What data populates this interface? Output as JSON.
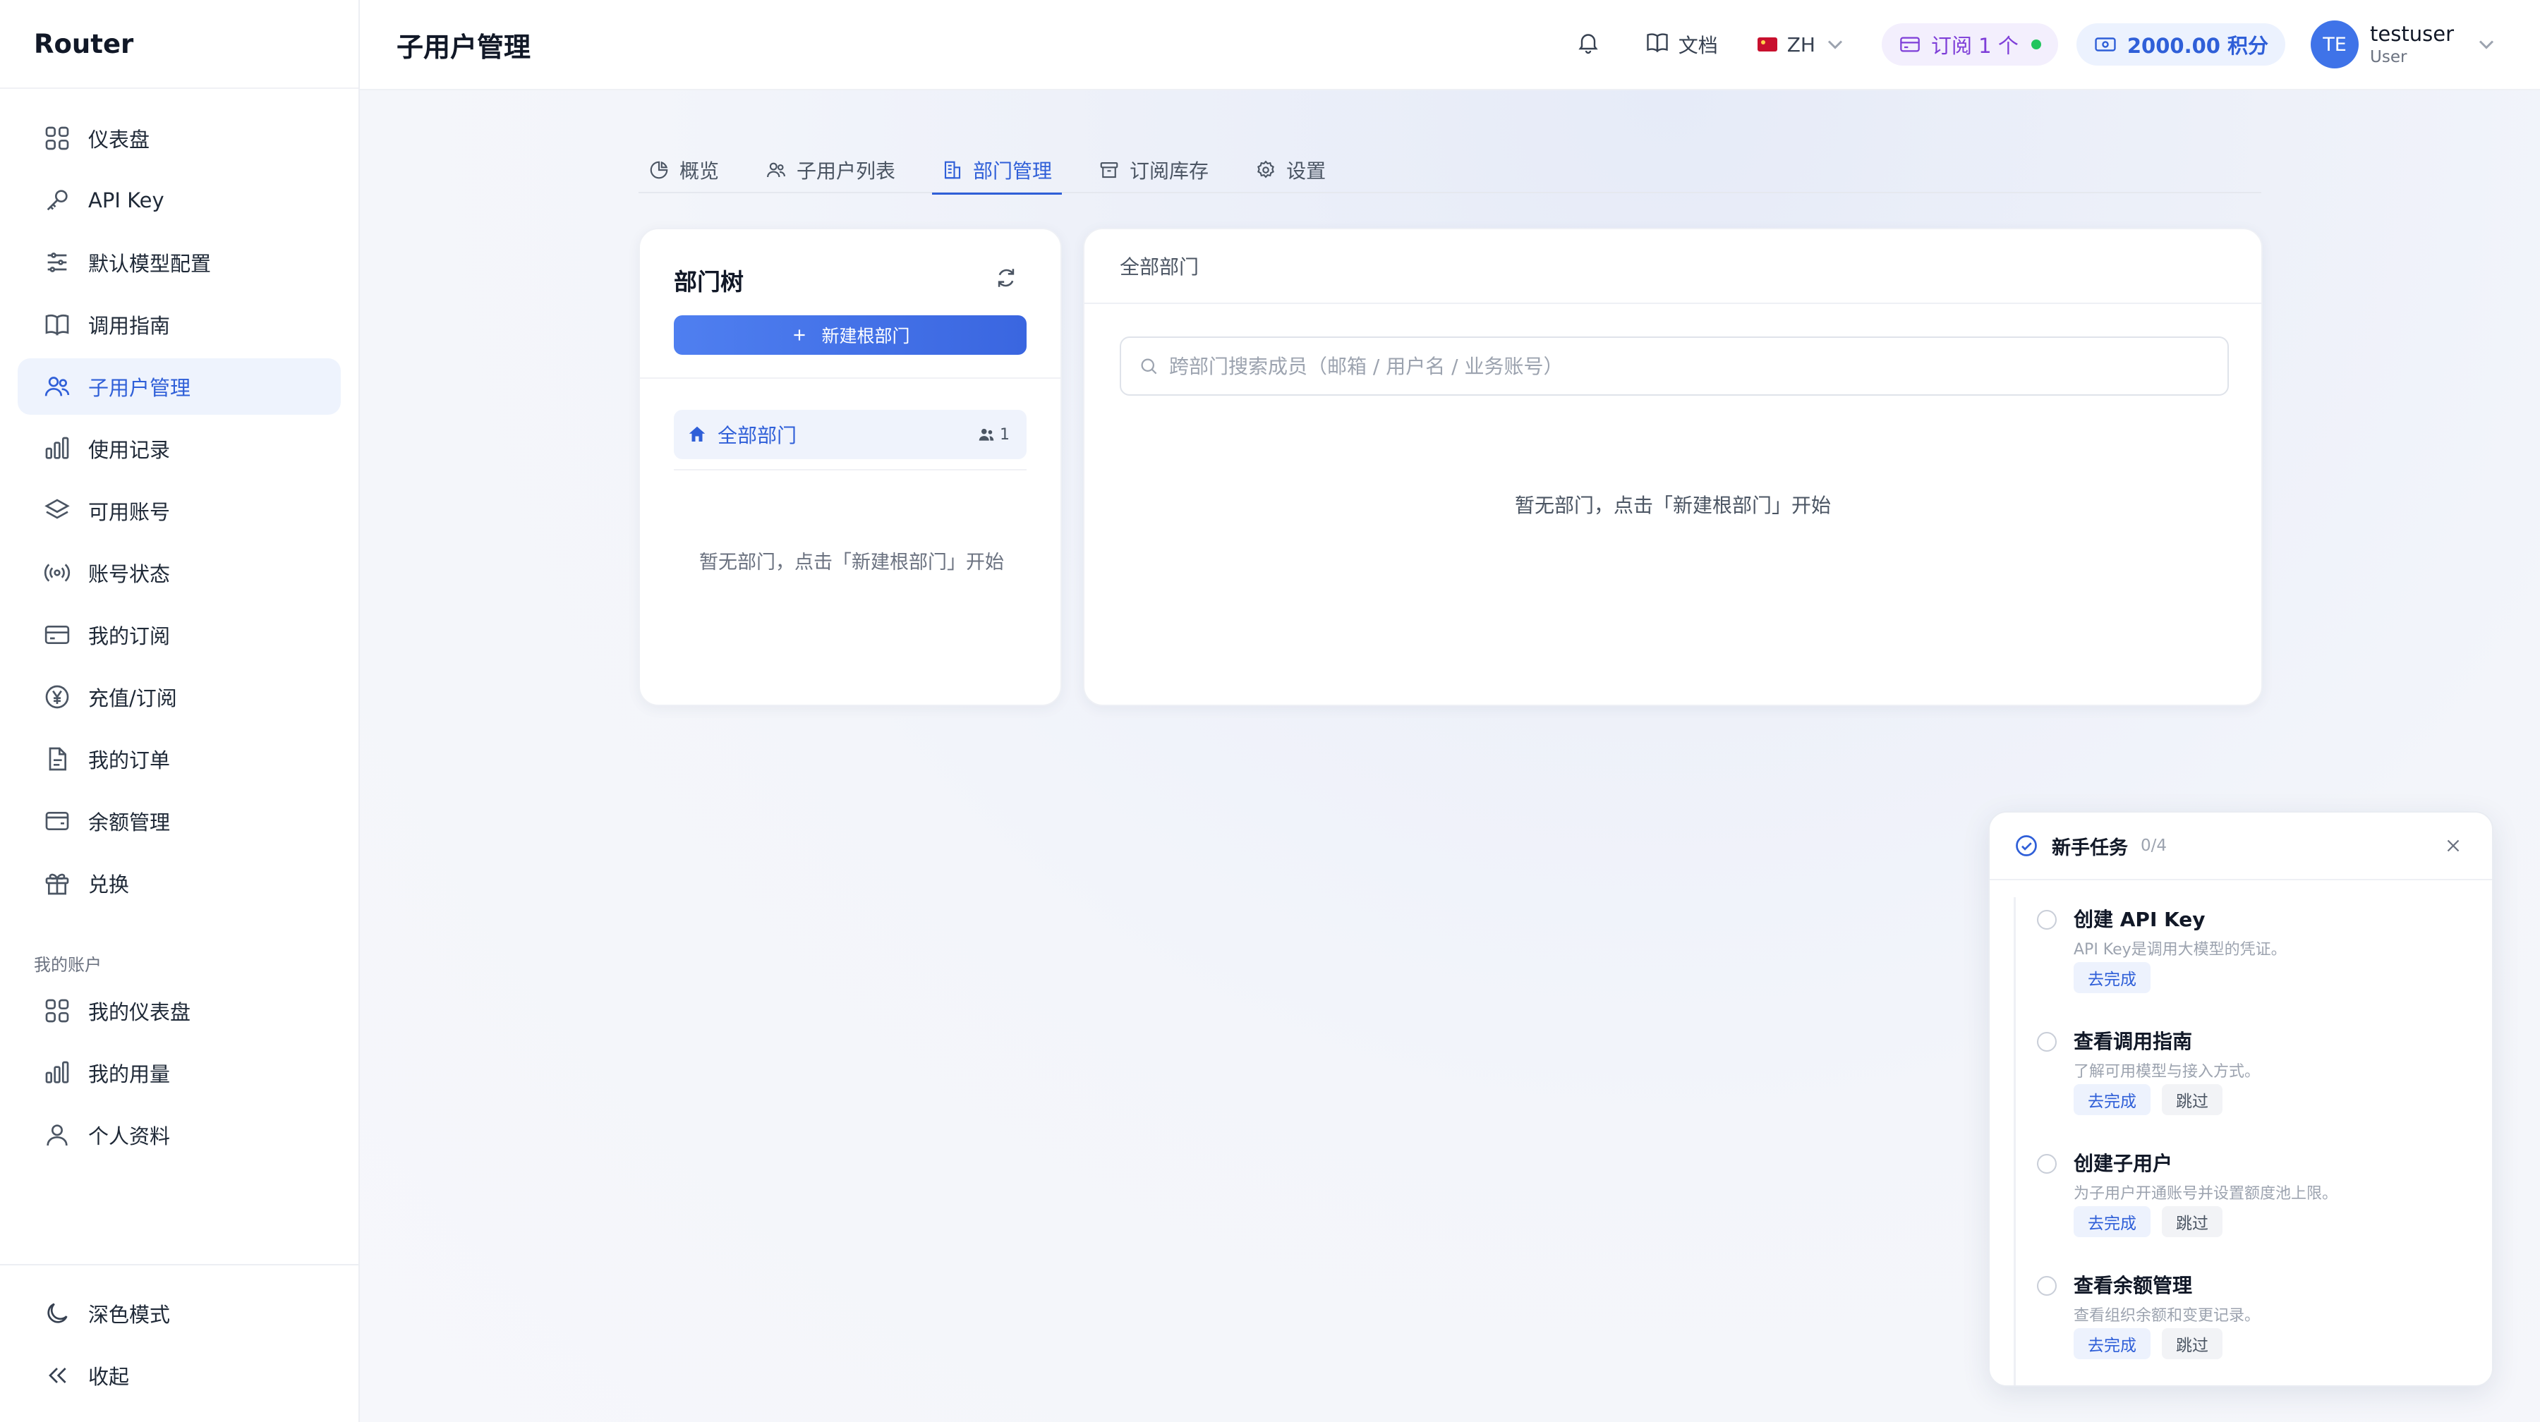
{
  "brand": "Router",
  "sidebar": {
    "items": [
      {
        "label": "仪表盘",
        "icon": "grid-icon"
      },
      {
        "label": "API Key",
        "icon": "key-icon"
      },
      {
        "label": "默认模型配置",
        "icon": "sliders-icon"
      },
      {
        "label": "调用指南",
        "icon": "book-icon"
      },
      {
        "label": "子用户管理",
        "icon": "users-icon",
        "active": true
      },
      {
        "label": "使用记录",
        "icon": "bar-chart-icon"
      },
      {
        "label": "可用账号",
        "icon": "layers-icon"
      },
      {
        "label": "账号状态",
        "icon": "broadcast-icon"
      },
      {
        "label": "我的订阅",
        "icon": "credit-card-icon"
      },
      {
        "label": "充值/订阅",
        "icon": "yen-icon"
      },
      {
        "label": "我的订单",
        "icon": "file-icon"
      },
      {
        "label": "余额管理",
        "icon": "wallet-icon"
      },
      {
        "label": "兑换",
        "icon": "gift-icon"
      }
    ],
    "section_label": "我的账户",
    "account_items": [
      {
        "label": "我的仪表盘",
        "icon": "grid-icon"
      },
      {
        "label": "我的用量",
        "icon": "bar-chart-icon"
      },
      {
        "label": "个人资料",
        "icon": "user-icon"
      }
    ],
    "bottom": {
      "dark_mode": "深色模式",
      "collapse": "收起"
    }
  },
  "header": {
    "title": "子用户管理",
    "docs": "文档",
    "lang": "ZH",
    "subscription": "订阅 1 个",
    "points": "2000.00 积分",
    "avatar_initials": "TE",
    "username": "testuser",
    "role": "User"
  },
  "tabs": [
    {
      "label": "概览",
      "icon": "pie-icon"
    },
    {
      "label": "子用户列表",
      "icon": "users-icon"
    },
    {
      "label": "部门管理",
      "icon": "building-icon",
      "active": true
    },
    {
      "label": "订阅库存",
      "icon": "archive-icon"
    },
    {
      "label": "设置",
      "icon": "gear-icon"
    }
  ],
  "tree": {
    "title": "部门树",
    "new_root_button": "新建根部门",
    "all_node": "全部部门",
    "all_count": "1",
    "empty_text": "暂无部门，点击「新建根部门」开始"
  },
  "dept_panel": {
    "header": "全部部门",
    "search_placeholder": "跨部门搜索成员（邮箱 / 用户名 / 业务账号）",
    "empty_text": "暂无部门，点击「新建根部门」开始"
  },
  "onboarding": {
    "title": "新手任务",
    "progress": "0/4",
    "tasks": [
      {
        "title": "创建 API Key",
        "desc": "API Key是调用大模型的凭证。",
        "go": "去完成",
        "skip": ""
      },
      {
        "title": "查看调用指南",
        "desc": "了解可用模型与接入方式。",
        "go": "去完成",
        "skip": "跳过"
      },
      {
        "title": "创建子用户",
        "desc": "为子用户开通账号并设置额度池上限。",
        "go": "去完成",
        "skip": "跳过"
      },
      {
        "title": "查看余额管理",
        "desc": "查看组织余额和变更记录。",
        "go": "去完成",
        "skip": "跳过"
      }
    ]
  },
  "colors": {
    "accent": "#2f5fd8",
    "subscription": "#7e3ed8",
    "status_ok": "#22c55e"
  }
}
